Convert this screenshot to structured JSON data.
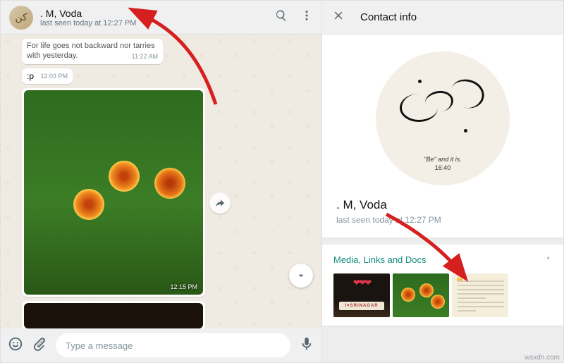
{
  "chat": {
    "contact_name": ". M, Voda",
    "status": "last seen today at 12:27 PM",
    "quote_msg": "For life goes not backward nor tarries with yesterday.",
    "quote_time": "11:22 AM",
    "small_msg": ":p",
    "small_time": "12:03 PM",
    "image_time": "12:15 PM",
    "input_placeholder": "Type a message"
  },
  "info": {
    "header_label": "Contact info",
    "pic_line1": "\"Be\" and it is.",
    "pic_line2": "16:40",
    "name": ". M, Voda",
    "status": "last seen today at 12:27 PM",
    "media_title": "Media, Links and Docs",
    "srinagar_sign": "I♥SRINAGAR"
  },
  "watermark": "wsxdn.com"
}
